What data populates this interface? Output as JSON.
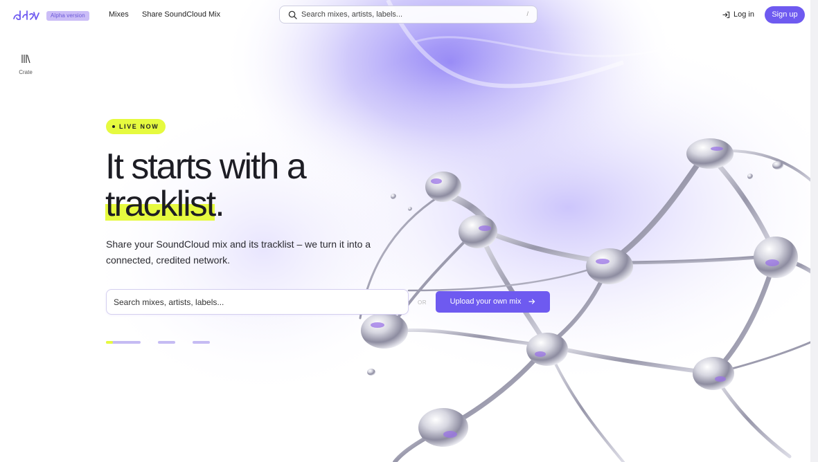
{
  "header": {
    "logo_icon": "brand-logo-icon",
    "badge": "Alpha version",
    "nav": [
      "Mixes",
      "Share SoundCloud Mix"
    ],
    "search_placeholder": "Search mixes, artists, labels...",
    "search_shortcut": "/",
    "login_label": "Log in",
    "signup_label": "Sign up"
  },
  "sidebar": {
    "crate_icon": "library-icon",
    "crate_label": "Crate"
  },
  "hero": {
    "badge": "LIVE NOW",
    "title_line1": "It starts with a",
    "title_highlight": "tracklist",
    "title_end": ".",
    "subtitle": "Share your SoundCloud mix and its tracklist – we turn it into a connected, credited network.",
    "search_placeholder": "Search mixes, artists, labels...",
    "or_label": "OR",
    "upload_label": "Upload your own mix",
    "upload_icon": "arrow-right-icon"
  },
  "colors": {
    "accent": "#6e5af0",
    "highlight": "#e6fa3f",
    "badge_bg": "#cbbdf7"
  }
}
